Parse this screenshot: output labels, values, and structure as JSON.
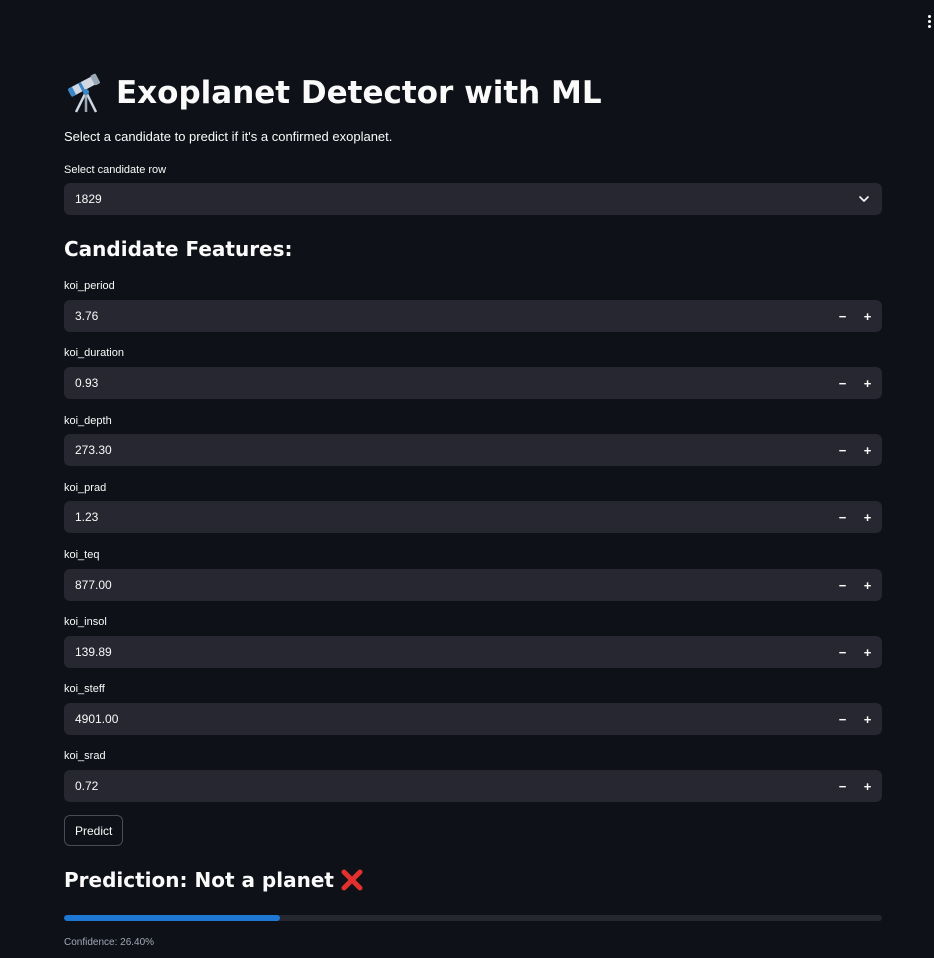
{
  "header": {
    "title": "Exoplanet Detector with ML",
    "subtitle": "Select a candidate to predict if it's a confirmed exoplanet."
  },
  "candidate_select": {
    "label": "Select candidate row",
    "value": "1829"
  },
  "features": {
    "heading": "Candidate Features:",
    "items": [
      {
        "label": "koi_period",
        "value": "3.76"
      },
      {
        "label": "koi_duration",
        "value": "0.93"
      },
      {
        "label": "koi_depth",
        "value": "273.30"
      },
      {
        "label": "koi_prad",
        "value": "1.23"
      },
      {
        "label": "koi_teq",
        "value": "877.00"
      },
      {
        "label": "koi_insol",
        "value": "139.89"
      },
      {
        "label": "koi_steff",
        "value": "4901.00"
      },
      {
        "label": "koi_srad",
        "value": "0.72"
      }
    ],
    "minus_symbol": "−",
    "plus_symbol": "+"
  },
  "predict_button": {
    "label": "Predict"
  },
  "result": {
    "prediction": "Prediction: Not a planet",
    "confidence_text": "Confidence: 26.40%",
    "confidence_value": 0.264
  },
  "colors": {
    "background": "#0e1117",
    "input_bg": "#262730",
    "progress_fill": "#1f77d4",
    "cross_red": "#e0312e"
  },
  "icons": {
    "title_icon": "telescope-icon",
    "result_icon": "cross-mark-icon",
    "select_icon": "chevron-down-icon",
    "menu_icon": "more-vertical-icon"
  }
}
